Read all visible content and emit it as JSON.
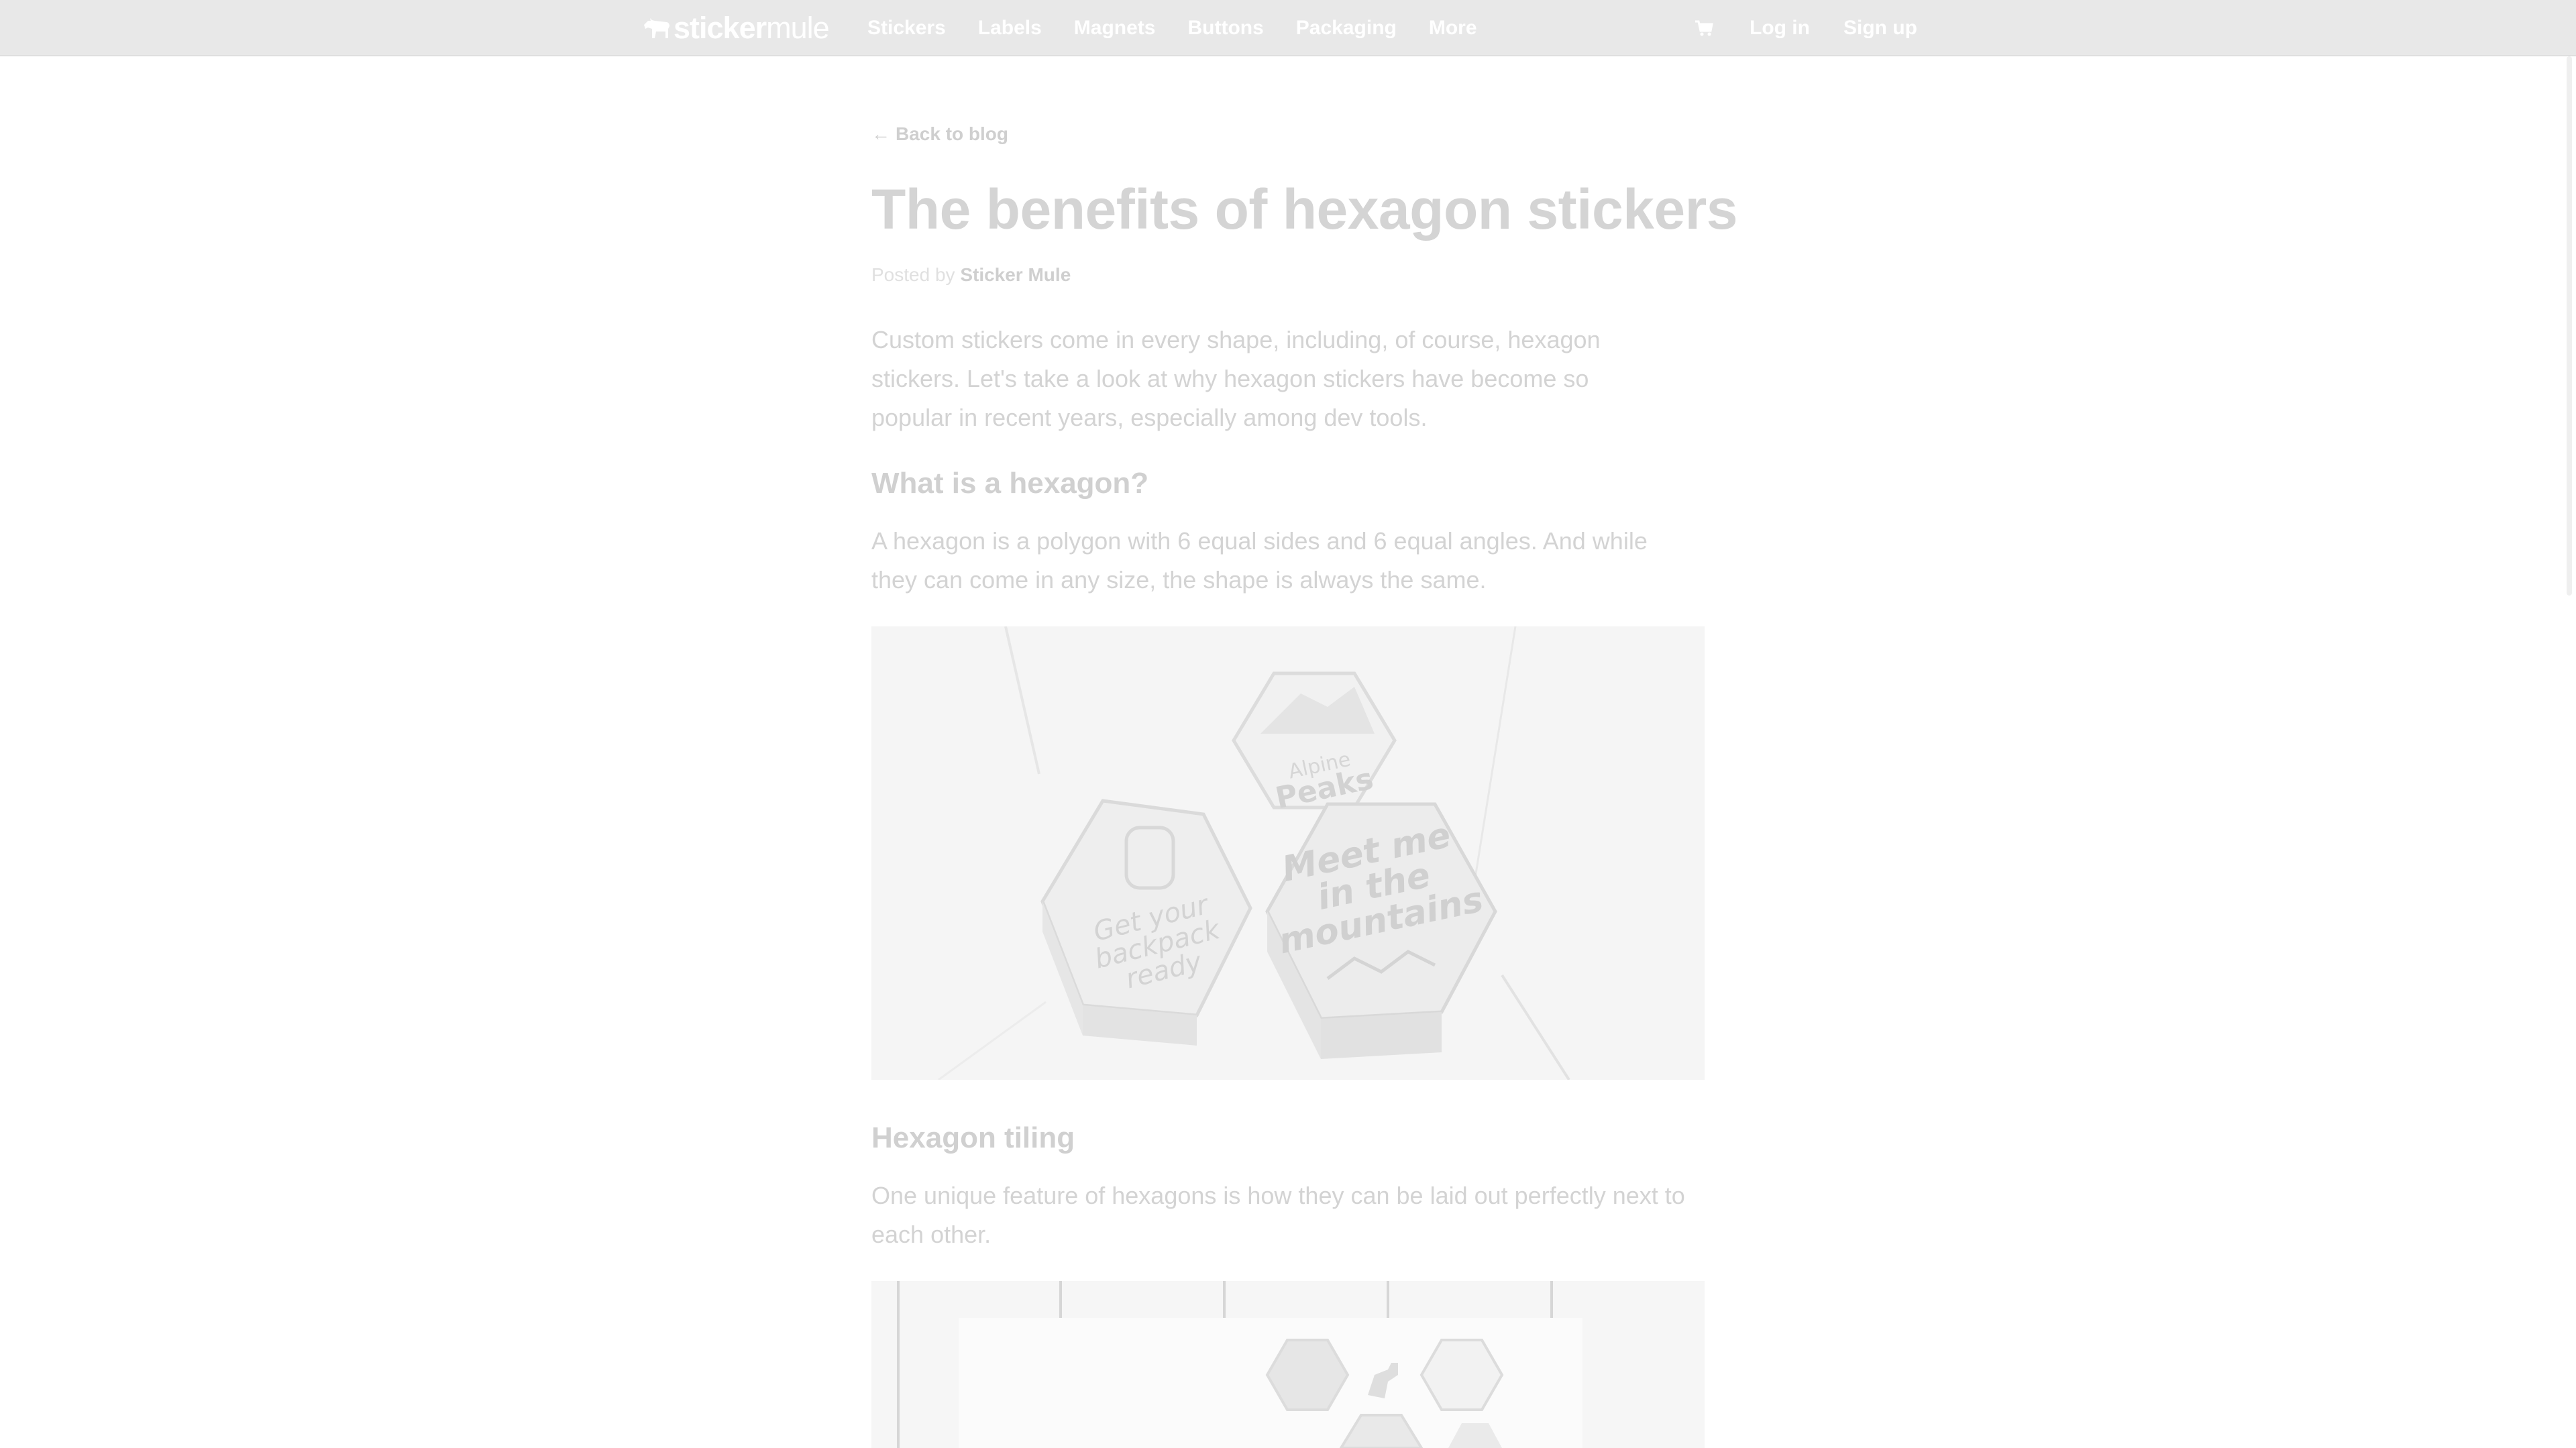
{
  "brand": {
    "word1": "sticker",
    "word2": "mule"
  },
  "nav": {
    "items": [
      "Stickers",
      "Labels",
      "Magnets",
      "Buttons",
      "Packaging",
      "More"
    ],
    "login": "Log in",
    "signup": "Sign up"
  },
  "article": {
    "back_label": "Back to blog",
    "title": "The benefits of hexagon stickers",
    "posted_by": "Posted by",
    "author": "Sticker Mule",
    "intro_lines": [
      "Custom stickers come in every shape, including, of course, hexagon",
      "stickers. Let's take a look at why hexagon stickers have become so",
      "popular in recent years, especially among dev tools."
    ],
    "section1_heading": "What is a hexagon?",
    "section1_lines": [
      "A hexagon is a polygon with 6 equal sides and 6 equal angles. And while",
      "they can come in any size, the shape is always the same."
    ],
    "figure1": {
      "sticker_top": [
        "Alpine",
        "Peaks"
      ],
      "sticker_left": [
        "Get your",
        "backpack",
        "ready"
      ],
      "sticker_right": [
        "Meet me",
        "in the",
        "mountains"
      ]
    },
    "section2_heading": "Hexagon tiling",
    "section2_lines": [
      "One unique feature of hexagons is how they can be laid out perfectly next to",
      "each other."
    ]
  },
  "colors": {
    "topbar": "#e8e8e8",
    "text": "#d3d3d3",
    "nav_text": "#ffffff"
  }
}
